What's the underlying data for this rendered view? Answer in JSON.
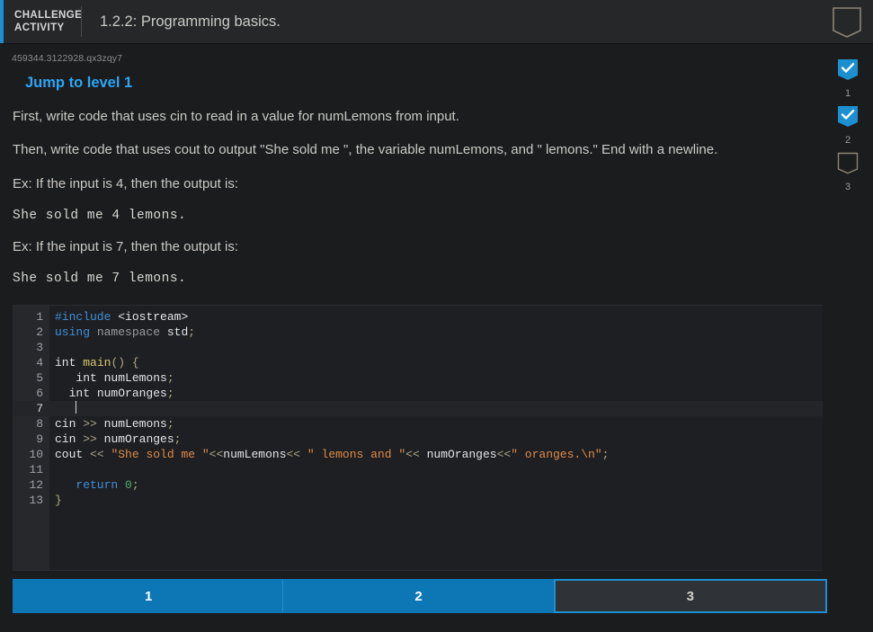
{
  "header": {
    "kicker": "CHALLENGE ACTIVITY",
    "title": "1.2.2: Programming basics.",
    "flag_icon": "bookmark-pennant-outline-icon",
    "accent_color": "#1b8fd0"
  },
  "activity": {
    "id": "459344.3122928.qx3zqy7",
    "jump_link": "Jump to level 1",
    "link_color": "#2ba6f7",
    "instructions": [
      "First, write code that uses cin to read in a value for numLemons from input.",
      "Then, write code that uses cout to output \"She sold me \", the variable numLemons, and \" lemons.\" End with a newline."
    ],
    "examples": [
      {
        "prompt": "Ex: If the input is 4, then the output is:",
        "output": "She sold me 4 lemons."
      },
      {
        "prompt": "Ex: If the input is 7, then the output is:",
        "output": "She sold me 7 lemons."
      }
    ]
  },
  "editor": {
    "language": "cpp",
    "active_line": 7,
    "lines": [
      {
        "n": "1",
        "text": "#include <iostream>"
      },
      {
        "n": "2",
        "text": "using namespace std;"
      },
      {
        "n": "3",
        "text": ""
      },
      {
        "n": "4",
        "text": "int main() {"
      },
      {
        "n": "5",
        "text": "   int numLemons;"
      },
      {
        "n": "6",
        "text": "  int numOranges;"
      },
      {
        "n": "7",
        "text": "   "
      },
      {
        "n": "8",
        "text": "cin >> numLemons;"
      },
      {
        "n": "9",
        "text": "cin >> numOranges;"
      },
      {
        "n": "10",
        "text": "cout << \"She sold me \"<<numLemons<< \" lemons and \"<< numOranges<<\" oranges.\\n\";"
      },
      {
        "n": "11",
        "text": ""
      },
      {
        "n": "12",
        "text": "   return 0;"
      },
      {
        "n": "13",
        "text": "}"
      }
    ]
  },
  "rail": {
    "items": [
      {
        "label": "1",
        "state": "complete",
        "icon": "bookmark-check-filled-icon"
      },
      {
        "label": "2",
        "state": "complete",
        "icon": "bookmark-check-filled-icon"
      },
      {
        "label": "3",
        "state": "incomplete",
        "icon": "bookmark-pennant-outline-icon"
      }
    ],
    "complete_color": "#1b8fd0"
  },
  "tabs": [
    {
      "label": "1",
      "state": "done"
    },
    {
      "label": "2",
      "state": "done"
    },
    {
      "label": "3",
      "state": "current"
    }
  ]
}
